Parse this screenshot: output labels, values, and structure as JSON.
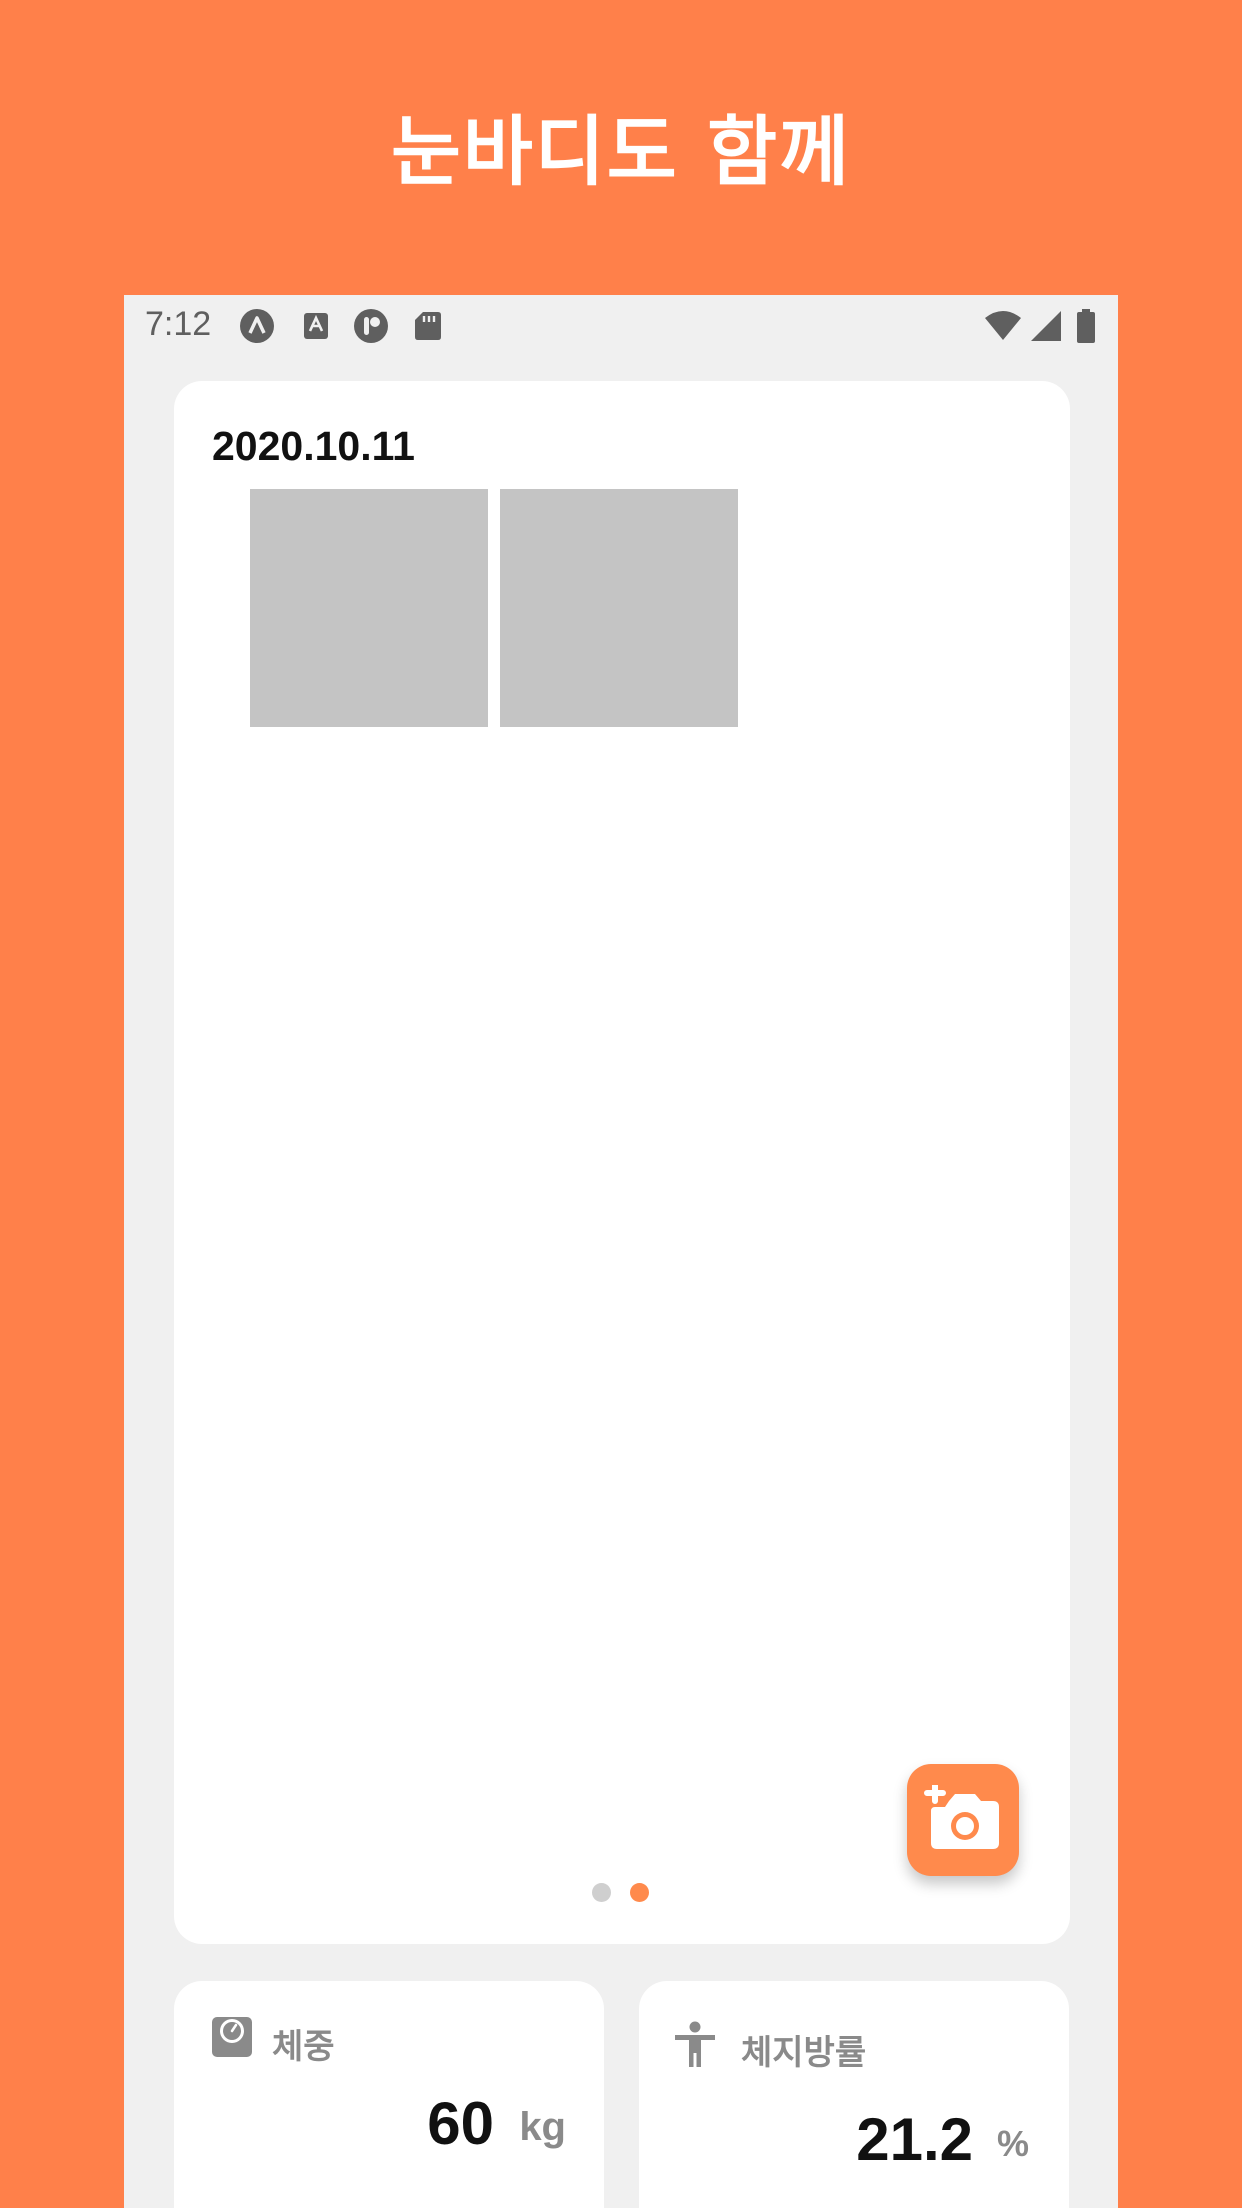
{
  "promo": {
    "headline": "눈바디도 함께"
  },
  "status_bar": {
    "time": "7:12",
    "left_icons": [
      "notification-a-icon",
      "text-a-icon",
      "notification-p-icon",
      "sd-card-icon"
    ],
    "right_icons": [
      "wifi-icon",
      "cell-signal-icon",
      "battery-icon"
    ]
  },
  "photo_card": {
    "date": "2020.10.11",
    "photos": [
      "photo-1",
      "photo-2"
    ],
    "add_photo_icon": "add-photo-camera-icon",
    "pager": {
      "count": 2,
      "active_index": 1
    }
  },
  "stats": {
    "weight": {
      "label": "체중",
      "value": "60",
      "unit": "kg",
      "icon": "scale-icon"
    },
    "body_fat": {
      "label": "체지방률",
      "value": "21.2",
      "unit": "%",
      "icon": "person-icon"
    }
  },
  "colors": {
    "brand": "#FF804A",
    "accent": "#FF8A4C",
    "screen_bg": "#F0F0F0",
    "card_bg": "#FFFFFF",
    "placeholder": "#C4C4C4",
    "muted_text": "#8A8A8A",
    "dot_inactive": "#CFCFCF"
  }
}
